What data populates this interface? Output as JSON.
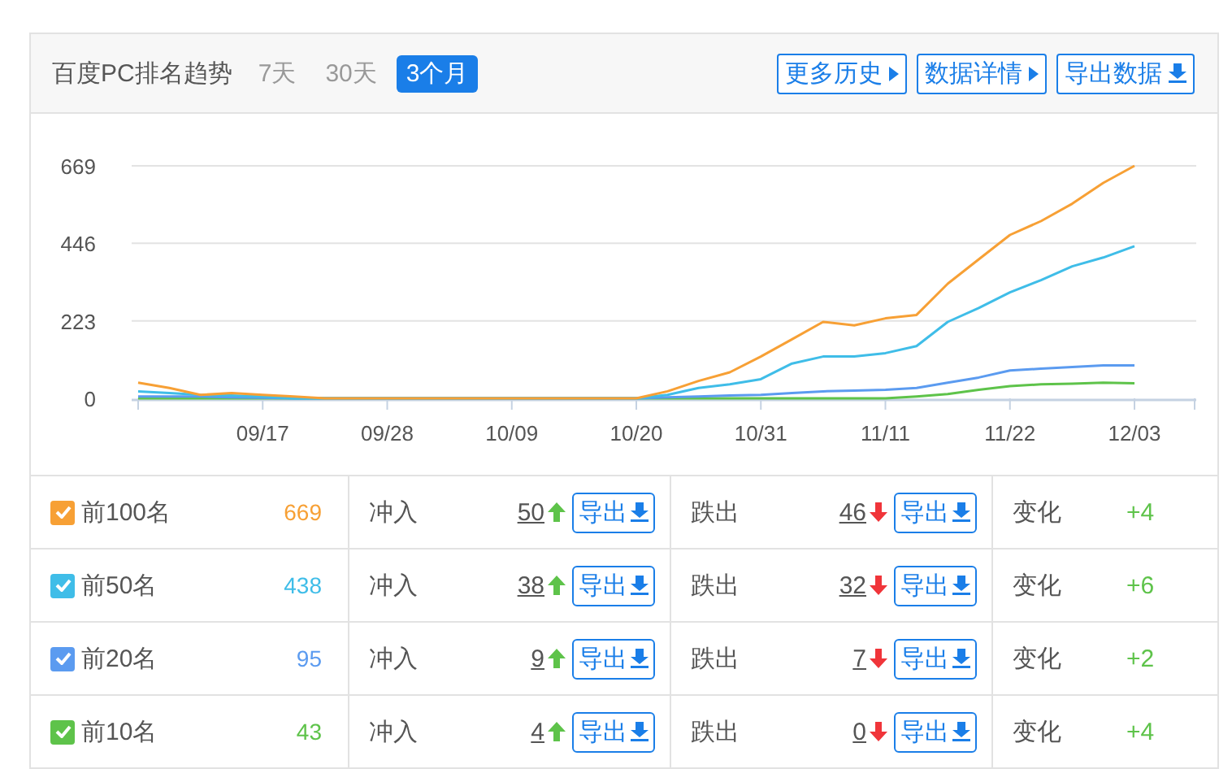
{
  "header": {
    "title": "百度PC排名趋势",
    "ranges": [
      {
        "label": "7天",
        "selected": false
      },
      {
        "label": "30天",
        "selected": false
      },
      {
        "label": "3个月",
        "selected": true
      }
    ],
    "buttons": [
      {
        "label": "更多历史",
        "kind": "more"
      },
      {
        "label": "数据详情",
        "kind": "more"
      },
      {
        "label": "导出数据",
        "kind": "export"
      }
    ]
  },
  "chart": {
    "chart_data": {
      "type": "line",
      "ylim": [
        0,
        669
      ],
      "yticks": [
        0,
        223,
        446,
        669
      ],
      "categories": [
        null,
        null,
        null,
        null,
        "09/17",
        null,
        null,
        null,
        "09/28",
        null,
        null,
        null,
        "10/09",
        null,
        null,
        null,
        "10/20",
        null,
        null,
        null,
        "10/31",
        null,
        null,
        null,
        "11/11",
        null,
        null,
        null,
        "11/22",
        null,
        null,
        null,
        "12/03"
      ],
      "series": [
        {
          "color": "#f7a035",
          "values": [
            45,
            30,
            10,
            15,
            10,
            5,
            0,
            0,
            0,
            0,
            0,
            0,
            0,
            0,
            0,
            0,
            0,
            20,
            50,
            75,
            120,
            170,
            220,
            210,
            230,
            240,
            330,
            400,
            470,
            510,
            560,
            620,
            669
          ]
        },
        {
          "color": "#3fbde8",
          "values": [
            20,
            15,
            10,
            8,
            5,
            0,
            0,
            0,
            0,
            0,
            0,
            0,
            0,
            0,
            0,
            0,
            0,
            10,
            30,
            40,
            55,
            100,
            120,
            120,
            130,
            150,
            220,
            260,
            305,
            340,
            380,
            405,
            438
          ]
        },
        {
          "color": "#5b9bf0",
          "values": [
            5,
            5,
            5,
            3,
            2,
            0,
            0,
            0,
            0,
            0,
            0,
            0,
            0,
            0,
            0,
            0,
            0,
            3,
            5,
            8,
            10,
            15,
            20,
            22,
            25,
            30,
            45,
            60,
            80,
            85,
            90,
            95,
            95
          ]
        },
        {
          "color": "#5ec34a",
          "values": [
            0,
            0,
            0,
            0,
            0,
            0,
            0,
            0,
            0,
            0,
            0,
            0,
            0,
            0,
            0,
            0,
            0,
            0,
            0,
            0,
            0,
            0,
            0,
            0,
            0,
            5,
            12,
            25,
            35,
            40,
            42,
            45,
            43
          ]
        }
      ]
    }
  },
  "rows": [
    {
      "label": "前100名",
      "checked": true,
      "color": "#f7a035",
      "count": "669",
      "in_label": "冲入",
      "in_value": "50",
      "in_export": "导出",
      "out_label": "跌出",
      "out_value": "46",
      "out_export": "导出",
      "change_label": "变化",
      "change": "+4"
    },
    {
      "label": "前50名",
      "checked": true,
      "color": "#3fbde8",
      "count": "438",
      "in_label": "冲入",
      "in_value": "38",
      "in_export": "导出",
      "out_label": "跌出",
      "out_value": "32",
      "out_export": "导出",
      "change_label": "变化",
      "change": "+6"
    },
    {
      "label": "前20名",
      "checked": true,
      "color": "#5b9bf0",
      "count": "95",
      "in_label": "冲入",
      "in_value": "9",
      "in_export": "导出",
      "out_label": "跌出",
      "out_value": "7",
      "out_export": "导出",
      "change_label": "变化",
      "change": "+2"
    },
    {
      "label": "前10名",
      "checked": true,
      "color": "#5ec34a",
      "count": "43",
      "in_label": "冲入",
      "in_value": "4",
      "in_export": "导出",
      "out_label": "跌出",
      "out_value": "0",
      "out_export": "导出",
      "change_label": "变化",
      "change": "+4"
    }
  ]
}
